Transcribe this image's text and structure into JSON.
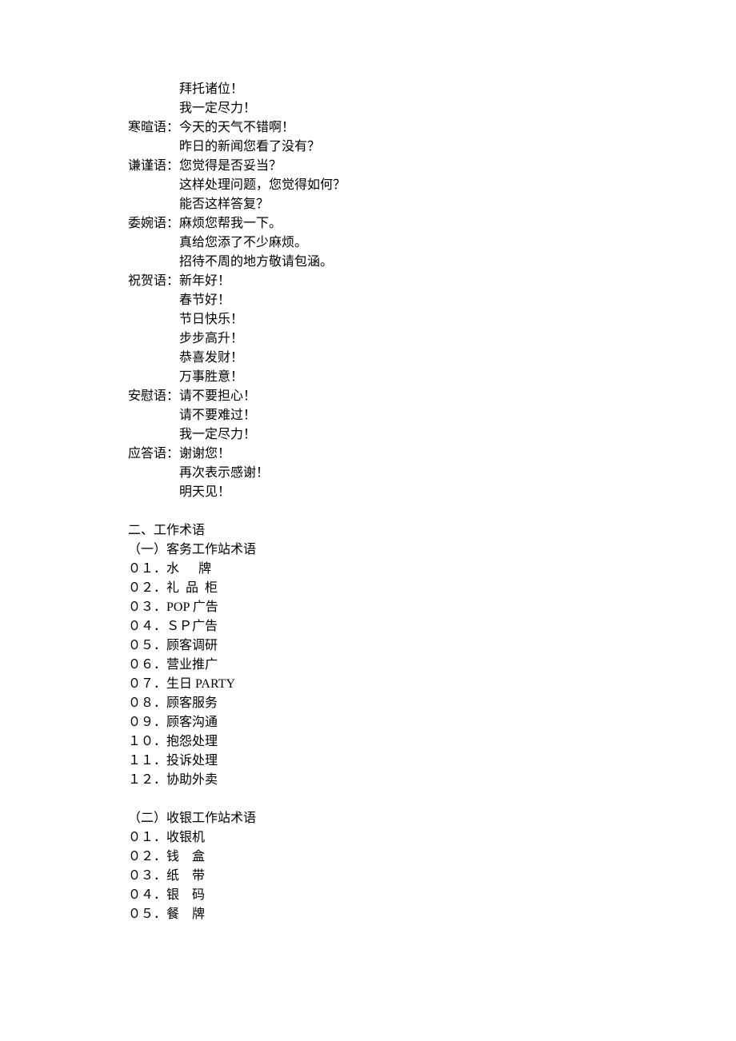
{
  "lines": [
    {
      "cls": "indent-line",
      "text": "拜托诸位！"
    },
    {
      "cls": "indent-line",
      "text": "我一定尽力！"
    },
    {
      "cls": "category-line",
      "text": "寒暄语：今天的天气不错啊！"
    },
    {
      "cls": "indent-line",
      "text": "昨日的新闻您看了没有？"
    },
    {
      "cls": "category-line",
      "text": "谦谨语：您觉得是否妥当？"
    },
    {
      "cls": "indent-line",
      "text": "这样处理问题，您觉得如何？"
    },
    {
      "cls": "indent-line",
      "text": "能否这样答复？"
    },
    {
      "cls": "category-line",
      "text": "委婉语：麻烦您帮我一下。"
    },
    {
      "cls": "indent-line",
      "text": "真给您添了不少麻烦。"
    },
    {
      "cls": "indent-line",
      "text": "招待不周的地方敬请包涵。"
    },
    {
      "cls": "category-line",
      "text": "祝贺语：新年好！"
    },
    {
      "cls": "indent-line",
      "text": "春节好！"
    },
    {
      "cls": "indent-line",
      "text": "节日快乐！"
    },
    {
      "cls": "indent-line",
      "text": "步步高升！"
    },
    {
      "cls": "indent-line",
      "text": "恭喜发财！"
    },
    {
      "cls": "indent-line",
      "text": "万事胜意！"
    },
    {
      "cls": "category-line",
      "text": "安慰语：请不要担心！"
    },
    {
      "cls": "indent-line",
      "text": "请不要难过！"
    },
    {
      "cls": "indent-line",
      "text": "我一定尽力！"
    },
    {
      "cls": "category-line",
      "text": "应答语：谢谢您！"
    },
    {
      "cls": "indent-line",
      "text": "再次表示感谢！"
    },
    {
      "cls": "indent-line",
      "text": "明天见！"
    },
    {
      "cls": "blank-line",
      "text": ""
    },
    {
      "cls": "section-title",
      "text": "二、工作术语"
    },
    {
      "cls": "section-title",
      "text": "（一）客务工作站术语"
    },
    {
      "cls": "category-line",
      "text": "０１．水      牌"
    },
    {
      "cls": "category-line",
      "text": "０２．礼  品  柜"
    },
    {
      "cls": "category-line",
      "text": "０３．POP 广告"
    },
    {
      "cls": "category-line",
      "text": "０４．ＳＰ广告"
    },
    {
      "cls": "category-line",
      "text": "０５．顾客调研"
    },
    {
      "cls": "category-line",
      "text": "０６．营业推广"
    },
    {
      "cls": "category-line",
      "text": "０７．生日 PARTY"
    },
    {
      "cls": "category-line",
      "text": "０８．顾客服务"
    },
    {
      "cls": "category-line",
      "text": "０９．顾客沟通"
    },
    {
      "cls": "category-line",
      "text": "１０．抱怨处理"
    },
    {
      "cls": "category-line",
      "text": "１１．投诉处理"
    },
    {
      "cls": "category-line",
      "text": "１２．协助外卖"
    },
    {
      "cls": "blank-line",
      "text": ""
    },
    {
      "cls": "section-title",
      "text": "（二）收银工作站术语"
    },
    {
      "cls": "category-line",
      "text": "０１．收银机"
    },
    {
      "cls": "category-line",
      "text": "０２．钱    盒"
    },
    {
      "cls": "category-line",
      "text": "０３．纸    带"
    },
    {
      "cls": "category-line",
      "text": "０４．银    码"
    },
    {
      "cls": "category-line",
      "text": "０５．餐    牌"
    }
  ]
}
